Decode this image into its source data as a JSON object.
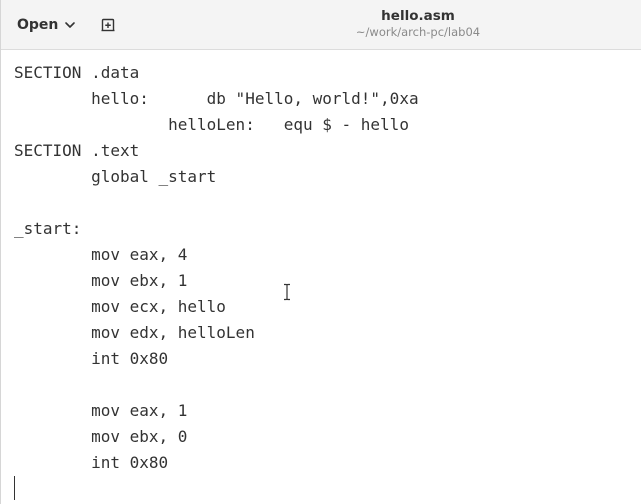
{
  "header": {
    "open_label": "Open",
    "title": "hello.asm",
    "path": "~/work/arch-pc/lab04"
  },
  "icons": {
    "open_menu": "chevron-down-icon",
    "new_tab": "new-tab-icon",
    "mouse": "text-ibeam-cursor-icon"
  },
  "editor": {
    "lines": [
      "SECTION .data",
      "        hello:      db \"Hello, world!\",0xa",
      "                helloLen:   equ $ - hello",
      "SECTION .text",
      "        global _start",
      "",
      "_start:",
      "        mov eax, 4",
      "        mov ebx, 1",
      "        mov ecx, hello",
      "        mov edx, helloLen",
      "        int 0x80",
      "",
      "        mov eax, 1",
      "        mov ebx, 0",
      "        int 0x80"
    ]
  }
}
